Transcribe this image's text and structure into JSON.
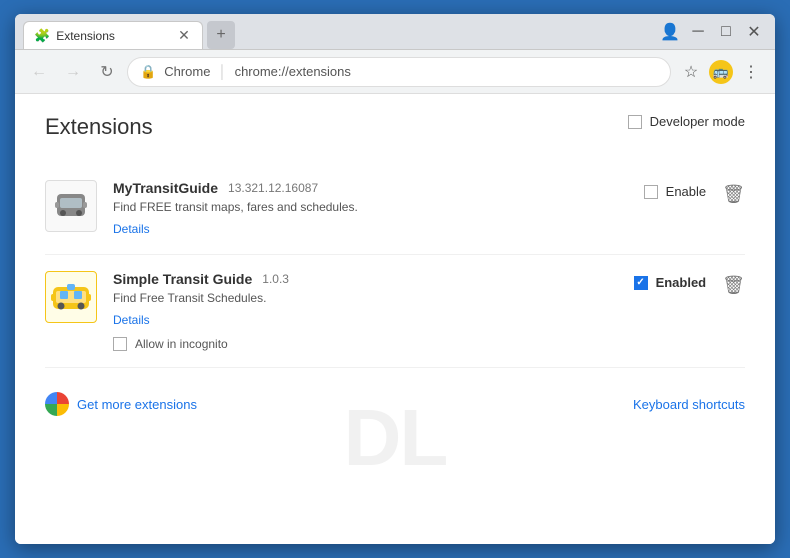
{
  "window": {
    "title": "Extensions",
    "minimize": "─",
    "maximize": "□",
    "close": "✕"
  },
  "tab": {
    "favicon": "🧩",
    "label": "Extensions",
    "close": "✕",
    "new_tab_label": "+"
  },
  "toolbar": {
    "back_label": "←",
    "forward_label": "→",
    "reload_label": "↻",
    "address_domain": "Chrome",
    "address_path": "chrome://extensions",
    "bookmark_icon": "☆",
    "transit_icon": "🚌",
    "menu_icon": "⋮",
    "account_icon": "👤"
  },
  "page": {
    "title": "Extensions",
    "developer_mode_label": "Developer mode"
  },
  "extensions": [
    {
      "id": "ext1",
      "name": "MyTransitGuide",
      "version": "13.321.12.16087",
      "description": "Find FREE transit maps, fares and schedules.",
      "details_label": "Details",
      "enable_label": "Enable",
      "enabled": false,
      "icon": "🚌"
    },
    {
      "id": "ext2",
      "name": "Simple Transit Guide",
      "version": "1.0.3",
      "description": "Find Free Transit Schedules.",
      "details_label": "Details",
      "enable_label": "Enabled",
      "enabled": true,
      "icon": "🚌",
      "allow_incognito_label": "Allow in incognito",
      "allow_incognito": false
    }
  ],
  "footer": {
    "get_more_label": "Get more extensions",
    "keyboard_shortcuts_label": "Keyboard shortcuts"
  }
}
